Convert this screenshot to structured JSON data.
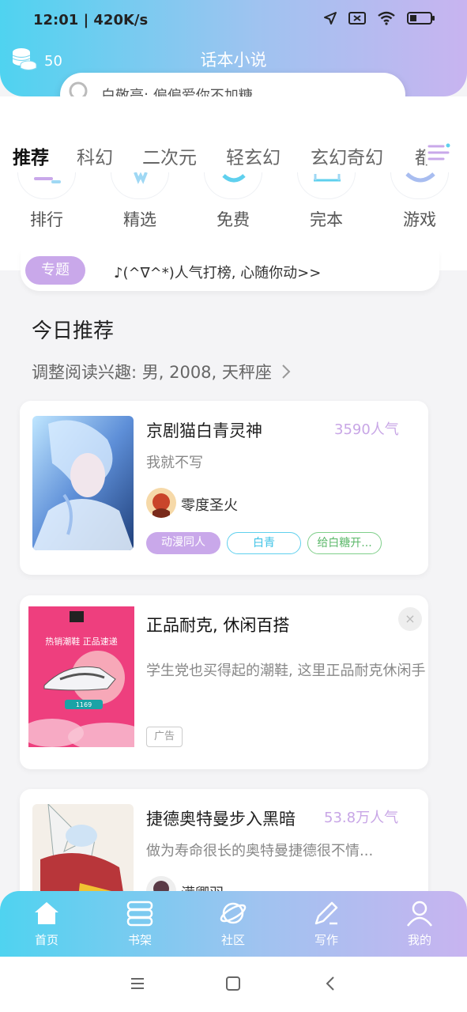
{
  "status": {
    "time": "12:01 | 420K/s"
  },
  "header": {
    "coins": "50",
    "title": "话本小说",
    "search_placeholder": "白敬亭: 偏偏爱你不加糖"
  },
  "tabs": [
    "推荐",
    "科幻",
    "二次元",
    "轻玄幻",
    "玄幻奇幻",
    "都"
  ],
  "quick_links": [
    "排行",
    "精选",
    "免费",
    "完本",
    "游戏"
  ],
  "topic": {
    "badge": "专题",
    "text": "♪(^∇^*)人气打榜, 心随你动>>"
  },
  "section": {
    "title": "今日推荐",
    "interest": "调整阅读兴趣: 男, 2008, 天秤座"
  },
  "books": [
    {
      "title": "京剧猫白青灵神",
      "popularity": "3590人气",
      "desc": "我就不写",
      "author": "零度圣火",
      "tags": [
        "动漫同人",
        "白青",
        "给白糖开..."
      ]
    },
    {
      "title": "捷德奥特曼步入黑暗",
      "popularity": "53.8万人气",
      "desc": "做为寿命很长的奥特曼捷德很不情...",
      "author": "满卿羽"
    }
  ],
  "ad": {
    "title": "正品耐克, 休闲百搭",
    "desc": "学生党也买得起的潮鞋, 这里正品耐克休闲手",
    "badge": "广告",
    "close": "×",
    "cover_headline": "热销潮鞋 正品速递",
    "cover_price": "1169"
  },
  "bottom_nav": [
    "首页",
    "书架",
    "社区",
    "写作",
    "我的"
  ],
  "colors": {
    "accent_cyan": "#4fd3f0",
    "accent_purple": "#c8b4f0",
    "tag_purple": "#c9a8ea"
  }
}
